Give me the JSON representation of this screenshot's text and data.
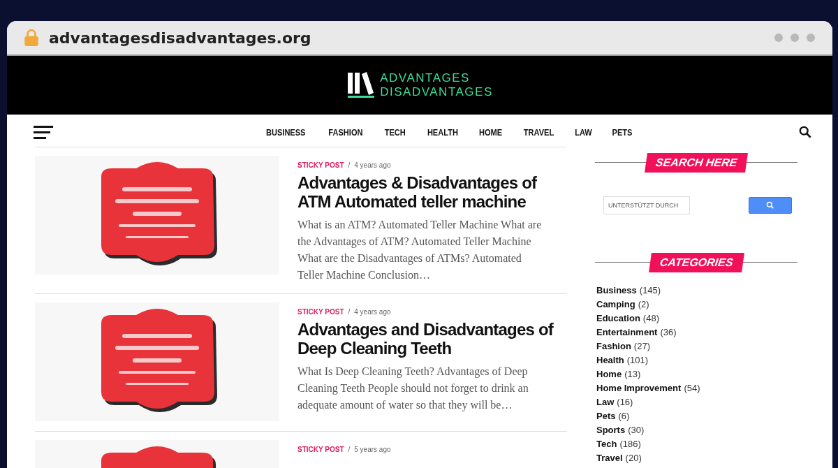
{
  "browser": {
    "url": "advantagesdisadvantages.org"
  },
  "logo": {
    "line_1": "ADVANTAGES",
    "line_2": "DISADVANTAGES"
  },
  "nav": {
    "items": [
      {
        "label": "BUSINESS"
      },
      {
        "label": "FASHION"
      },
      {
        "label": "TECH"
      },
      {
        "label": "HEALTH"
      },
      {
        "label": "HOME"
      },
      {
        "label": "TRAVEL"
      },
      {
        "label": "LAW"
      },
      {
        "label": "PETS"
      }
    ]
  },
  "posts": [
    {
      "tag": "STICKY POST",
      "separator": "/",
      "age": "4 years ago",
      "title": "Advantages & Disadvantages of ATM Automated teller machine",
      "excerpt": "What is an ATM? Automated Teller Machine What are the Advantages of ATM? Automated Teller Machine What are the Disadvantages of ATMs? Automated Teller Machine Conclusion…"
    },
    {
      "tag": "STICKY POST",
      "separator": "/",
      "age": "4 years ago",
      "title": "Advantages and Disadvantages of Deep Cleaning Teeth",
      "excerpt": "What Is Deep Cleaning Teeth? Advantages of Deep Cleaning Teeth People should not forget to drink an adequate amount of water so that they will be…"
    },
    {
      "tag": "STICKY POST",
      "separator": "/",
      "age": "5 years ago"
    }
  ],
  "sidebar": {
    "search_heading": "SEARCH HERE",
    "search_placeholder": "UNTERSTÜTZT DURCH",
    "categories_heading": "CATEGORIES",
    "categories": [
      {
        "name": "Business",
        "count": "(145)"
      },
      {
        "name": "Camping",
        "count": "(2)"
      },
      {
        "name": "Education",
        "count": "(48)"
      },
      {
        "name": "Entertainment",
        "count": "(36)"
      },
      {
        "name": "Fashion",
        "count": "(27)"
      },
      {
        "name": "Health",
        "count": "(101)"
      },
      {
        "name": "Home",
        "count": "(13)"
      },
      {
        "name": "Home Improvement",
        "count": "(54)"
      },
      {
        "name": "Law",
        "count": "(16)"
      },
      {
        "name": "Pets",
        "count": "(6)"
      },
      {
        "name": "Sports",
        "count": "(30)"
      },
      {
        "name": "Tech",
        "count": "(186)"
      },
      {
        "name": "Travel",
        "count": "(20)"
      }
    ]
  }
}
